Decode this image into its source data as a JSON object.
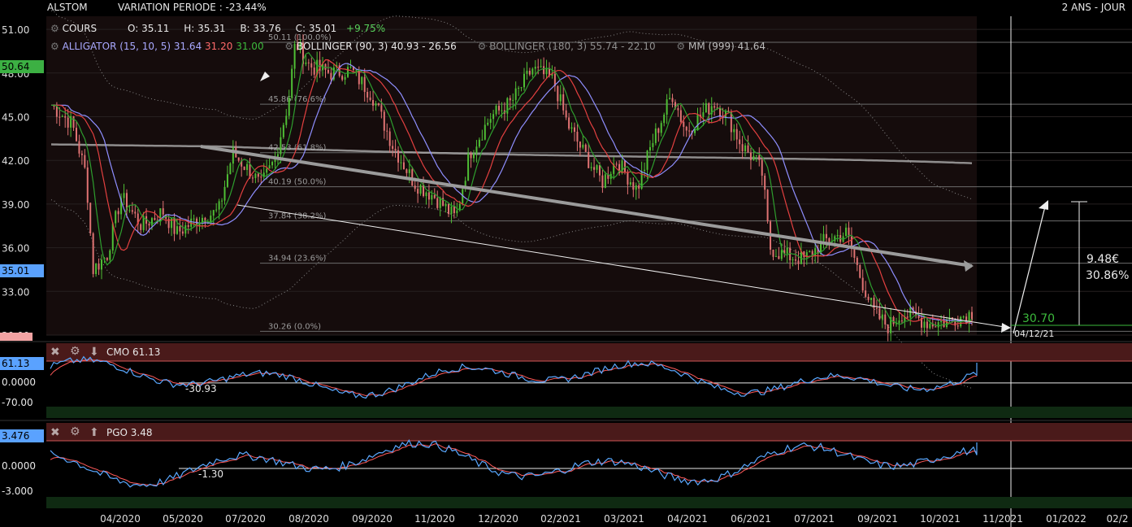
{
  "header": {
    "symbol": "ALSTOM",
    "variation": "VARIATION PERIODE : -23.44%",
    "period": "2 ANS - JOUR"
  },
  "quote": {
    "label": "COURS",
    "open": "O: 35.11",
    "high": "H: 35.31",
    "low": "B: 33.76",
    "close": "C: 35.01",
    "change": "+9.75%"
  },
  "indicators": {
    "alligator_name": "ALLIGATOR (15, 10, 5)",
    "alligator_jaw": "31.64",
    "alligator_teeth": "31.20",
    "alligator_lips": "31.00",
    "bollinger1": "BOLLINGER (90, 3) 40.93 - 26.56",
    "bollinger2": "BOLLINGER (180, 3) 55.74 - 22.10",
    "mm": "MM (999) 41.64"
  },
  "price_tags": {
    "high": "50.64",
    "last": "35.01",
    "low": "30.70"
  },
  "annotations": {
    "diff_value": "9.48€",
    "diff_pct": "30.86%",
    "target_value": "30.70",
    "date_marker": "04/12/21"
  },
  "cmo_panel": {
    "label": "CMO 61.13",
    "tag": "61.13",
    "ticks": [
      "0.0000",
      "-70.00"
    ],
    "line_label": "-30.93"
  },
  "pgo_panel": {
    "label": "PGO 3.48",
    "tag": "3.476",
    "ticks": [
      "0.0000",
      "-3.000"
    ],
    "line_label": "-1.30"
  },
  "colors": {
    "background": "#000000",
    "plot_bg": "#150c0c",
    "candle_up": "#4fbf35",
    "candle_down": "#e07373",
    "jaw": "#8f8fff",
    "teeth": "#e34040",
    "lips": "#2e9e2e",
    "mm": "#b8b8b8",
    "indicator_fast": "#5aa8ff",
    "indicator_slow": "#ff5a5a",
    "high_tag": "#3cb043",
    "last_tag": "#5aa2ff",
    "cmo_tag": "#5aa2ff",
    "pgo_tag": "#5aa2ff"
  },
  "chart_data": {
    "type": "candlestick",
    "x_tick_labels": [
      "04/2020",
      "05/2020",
      "07/2020",
      "08/2020",
      "09/2020",
      "11/2020",
      "12/2020",
      "02/2021",
      "03/2021",
      "04/2021",
      "06/2021",
      "07/2021",
      "09/2021",
      "10/2021",
      "11/2021",
      "01/2022",
      "02/2"
    ],
    "y_tick_labels": [
      "51.00",
      "48.00",
      "45.00",
      "42.00",
      "39.00",
      "36.00",
      "33.00",
      "30.00"
    ],
    "ylim": [
      30,
      51.9
    ],
    "fibonacci": [
      {
        "price": 50.11,
        "label": "50.11 (100.0%)"
      },
      {
        "price": 45.86,
        "label": "45.86 (76.6%)"
      },
      {
        "price": 42.53,
        "label": "42.53 (61.8%)"
      },
      {
        "price": 40.19,
        "label": "40.19 (50.0%)"
      },
      {
        "price": 37.84,
        "label": "37.84 (38.2%)"
      },
      {
        "price": 34.94,
        "label": "34.94 (23.6%)"
      },
      {
        "price": 30.26,
        "label": "30.26 (0.0%)"
      }
    ],
    "price_path": [
      {
        "t": 0,
        "p": 45.8
      },
      {
        "t": 3,
        "p": 44.5
      },
      {
        "t": 5,
        "p": 41.0
      },
      {
        "t": 6,
        "p": 34.5
      },
      {
        "t": 8,
        "p": 35.5
      },
      {
        "t": 10,
        "p": 39.5
      },
      {
        "t": 13,
        "p": 37.5
      },
      {
        "t": 16,
        "p": 38.5
      },
      {
        "t": 18,
        "p": 37.0
      },
      {
        "t": 21,
        "p": 38.0
      },
      {
        "t": 24,
        "p": 38.5
      },
      {
        "t": 26,
        "p": 42.5
      },
      {
        "t": 29,
        "p": 41.0
      },
      {
        "t": 30,
        "p": 40.2
      },
      {
        "t": 32,
        "p": 42.0
      },
      {
        "t": 34,
        "p": 46.0
      },
      {
        "t": 35,
        "p": 50.1
      },
      {
        "t": 37,
        "p": 48.5
      },
      {
        "t": 40,
        "p": 48.0
      },
      {
        "t": 43,
        "p": 48.2
      },
      {
        "t": 46,
        "p": 46.5
      },
      {
        "t": 49,
        "p": 43.0
      },
      {
        "t": 52,
        "p": 40.5
      },
      {
        "t": 55,
        "p": 39.5
      },
      {
        "t": 58,
        "p": 38.0
      },
      {
        "t": 60,
        "p": 42.5
      },
      {
        "t": 63,
        "p": 45.0
      },
      {
        "t": 66,
        "p": 46.0
      },
      {
        "t": 69,
        "p": 48.3
      },
      {
        "t": 72,
        "p": 47.5
      },
      {
        "t": 74,
        "p": 44.5
      },
      {
        "t": 76,
        "p": 42.8
      },
      {
        "t": 79,
        "p": 40.5
      },
      {
        "t": 81,
        "p": 42.0
      },
      {
        "t": 84,
        "p": 40.0
      },
      {
        "t": 86,
        "p": 43.0
      },
      {
        "t": 89,
        "p": 46.6
      },
      {
        "t": 91,
        "p": 44.0
      },
      {
        "t": 93,
        "p": 45.0
      },
      {
        "t": 95,
        "p": 46.0
      },
      {
        "t": 97,
        "p": 45.0
      },
      {
        "t": 99,
        "p": 43.0
      },
      {
        "t": 101,
        "p": 42.0
      },
      {
        "t": 102,
        "p": 41.0
      },
      {
        "t": 103,
        "p": 36.0
      },
      {
        "t": 105,
        "p": 35.5
      },
      {
        "t": 108,
        "p": 35.2
      },
      {
        "t": 111,
        "p": 36.5
      },
      {
        "t": 114,
        "p": 37.0
      },
      {
        "t": 116,
        "p": 34.0
      },
      {
        "t": 118,
        "p": 31.5
      },
      {
        "t": 120,
        "p": 30.6
      },
      {
        "t": 122,
        "p": 31.5
      },
      {
        "t": 124,
        "p": 31.2
      },
      {
        "t": 126,
        "p": 30.8
      },
      {
        "t": 128,
        "p": 30.9
      },
      {
        "t": 130,
        "p": 31.2
      },
      {
        "t": 132,
        "p": 31.5
      }
    ]
  }
}
